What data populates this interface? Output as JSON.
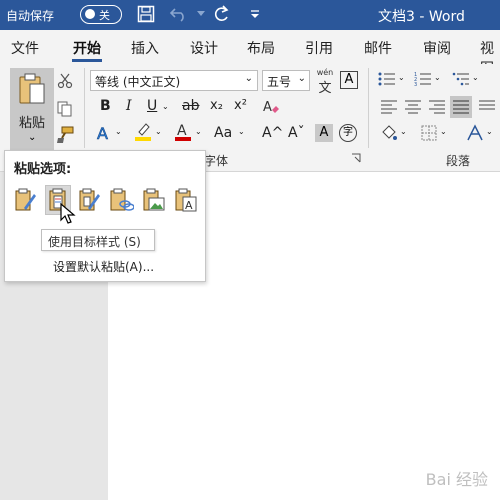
{
  "titlebar": {
    "autosave_label": "自动保存",
    "autosave_state": "关",
    "doc_title": "文档3 - Word"
  },
  "tabs": [
    {
      "label": "文件"
    },
    {
      "label": "开始"
    },
    {
      "label": "插入"
    },
    {
      "label": "设计"
    },
    {
      "label": "布局"
    },
    {
      "label": "引用"
    },
    {
      "label": "邮件"
    },
    {
      "label": "审阅"
    },
    {
      "label": "视图"
    }
  ],
  "ribbon": {
    "paste_label": "粘贴",
    "font_name": "等线 (中文正文)",
    "font_size": "五号",
    "wen_label": "wén",
    "a_box": "A",
    "bold": "B",
    "italic": "I",
    "underline": "U",
    "strike": "ab",
    "subscript": "x₂",
    "superscript": "x²",
    "aa": "Aa",
    "grow_font": "A^",
    "shrink_font": "Aˇ",
    "char_shading": "A",
    "char_circle": "字",
    "font_group_label": "字体",
    "para_group_label": "段落"
  },
  "paste_menu": {
    "title": "粘贴选项:",
    "tooltip": "使用目标样式 (S)",
    "default_paste": "设置默认粘贴(A)..."
  },
  "watermark": "Bai 经验",
  "colors": {
    "titlebar": "#2b579a",
    "highlight": "#ffd800",
    "font_color": "#d00000"
  }
}
